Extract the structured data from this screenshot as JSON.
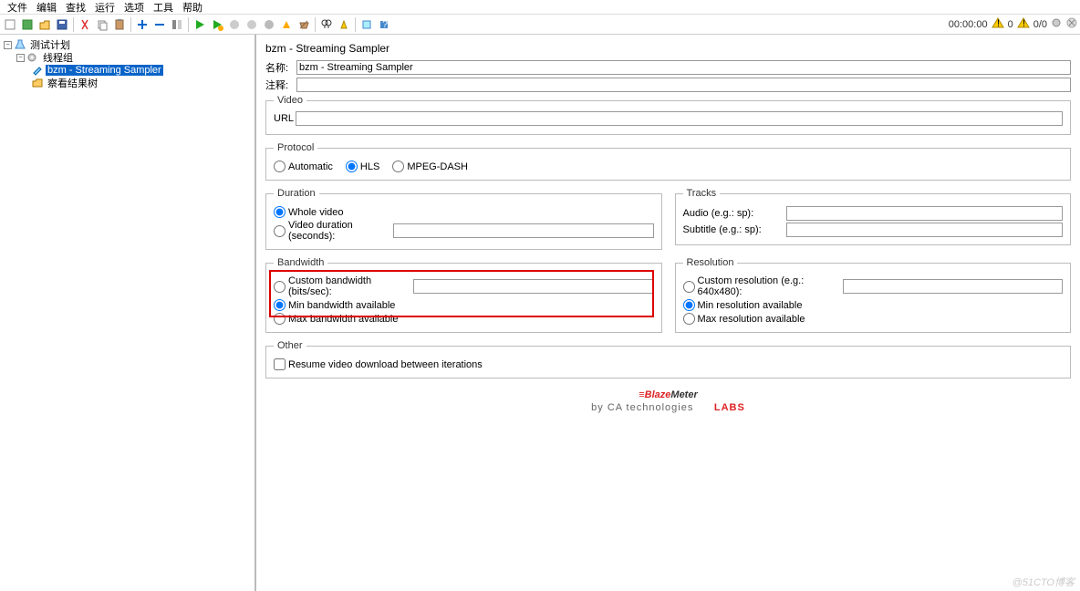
{
  "menu": [
    "文件",
    "编辑",
    "查找",
    "运行",
    "选项",
    "工具",
    "帮助"
  ],
  "status": {
    "time": "00:00:00",
    "warn": 0,
    "err": "0/0"
  },
  "tree": {
    "root": {
      "label": "测试计划"
    },
    "group": {
      "label": "线程组"
    },
    "sampler": {
      "label": "bzm - Streaming Sampler"
    },
    "viewer": {
      "label": "察看结果树"
    }
  },
  "panel": {
    "title": "bzm - Streaming Sampler",
    "name_label": "名称:",
    "name_value": "bzm - Streaming Sampler",
    "comment_label": "注释:",
    "comment_value": "",
    "video": {
      "legend": "Video",
      "url_label": "URL",
      "url_value": ""
    },
    "protocol": {
      "legend": "Protocol",
      "auto": "Automatic",
      "hls": "HLS",
      "dash": "MPEG-DASH"
    },
    "duration": {
      "legend": "Duration",
      "whole": "Whole video",
      "seconds_label": "Video duration (seconds):",
      "seconds_value": ""
    },
    "tracks": {
      "legend": "Tracks",
      "audio": "Audio (e.g.: sp):",
      "audio_value": "",
      "subtitle": "Subtitle (e.g.: sp):",
      "subtitle_value": ""
    },
    "bandwidth": {
      "legend": "Bandwidth",
      "custom": "Custom bandwidth (bits/sec):",
      "custom_value": "",
      "min": "Min bandwidth available",
      "max": "Max bandwidth available"
    },
    "resolution": {
      "legend": "Resolution",
      "custom": "Custom resolution (e.g.: 640x480):",
      "custom_value": "",
      "min": "Min resolution available",
      "max": "Max resolution available"
    },
    "other": {
      "legend": "Other",
      "resume": "Resume video download between iterations"
    },
    "logo": {
      "blaze": "Blaze",
      "meter": "Meter",
      "labs": "LABS",
      "by": "by CA technologies"
    }
  },
  "watermark": "@51CTO博客"
}
